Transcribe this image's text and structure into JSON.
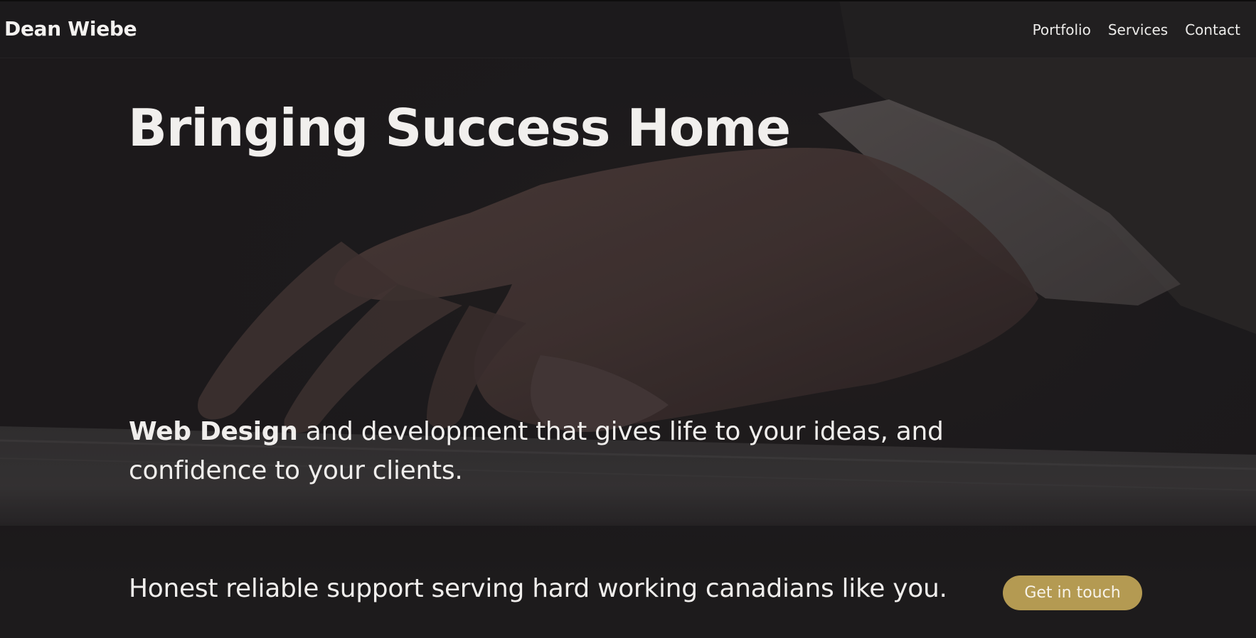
{
  "header": {
    "brand": "Dean Wiebe",
    "nav": [
      {
        "label": "Portfolio"
      },
      {
        "label": "Services"
      },
      {
        "label": "Contact"
      }
    ]
  },
  "hero": {
    "title": "Bringing Success Home",
    "tagline_bold": "Web Design",
    "tagline_rest": " and development that gives life to your ideas, and confidence to your clients.",
    "background_image": "hand-on-keyboard-photo"
  },
  "support": {
    "text": "Honest reliable support serving hard working canadians like you.",
    "cta_label": "Get in touch"
  },
  "colors": {
    "background": "#1c1a1b",
    "accent": "#b49a52",
    "text": "#f0eeec"
  }
}
